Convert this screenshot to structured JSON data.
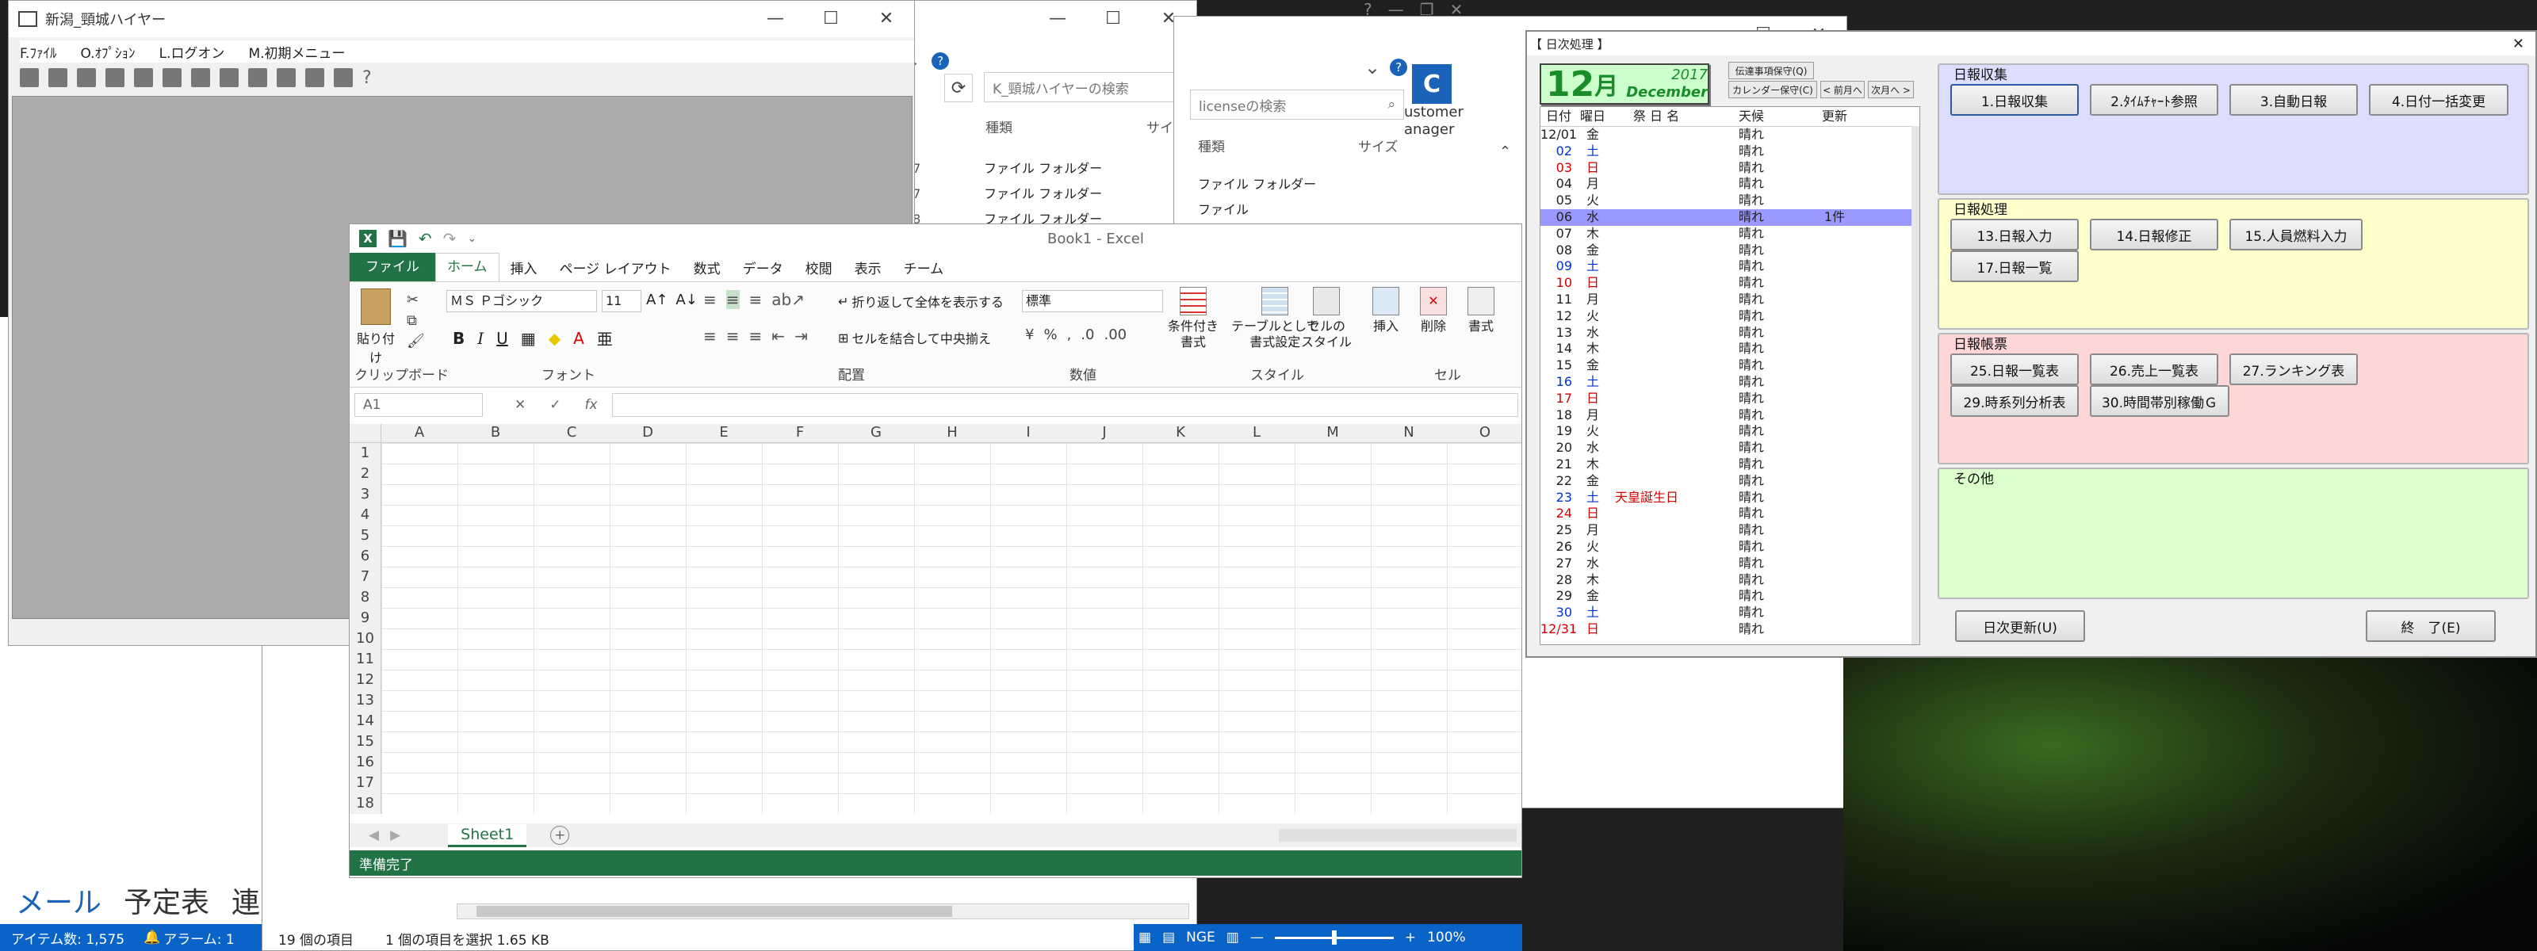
{
  "colors": {
    "excel_green": "#217346",
    "taskbar_blue": "#0a64c8",
    "outlook_blue": "#1a63b8",
    "cal_green": "#1a8c2a",
    "highlight_row": "#9999ff"
  },
  "haier_window": {
    "title": "新潟_頸城ハイヤー",
    "menu": [
      "F.ﾌｧｲﾙ",
      "O.ｵﾌﾟｼｮﾝ",
      "L.ログオン",
      "M.初期メニュー"
    ]
  },
  "explorer1": {
    "search_placeholder": "K_頸城ハイヤーの検索",
    "col_type": "種類",
    "col_size": "サイズ",
    "rows": [
      {
        "num": "57",
        "type": "ファイル フォルダー"
      },
      {
        "num": "57",
        "type": "ファイル フォルダー"
      },
      {
        "num": "58",
        "type": "ファイル フォルダー"
      }
    ]
  },
  "explorer2": {
    "search_placeholder": "licenseの検索",
    "col_type": "種類",
    "col_size": "サイズ",
    "rows": [
      "ファイル フォルダー",
      "ファイル"
    ],
    "customer_label1": "ustomer",
    "customer_label2": "anager"
  },
  "excel": {
    "title": "Book1 - Excel",
    "tabs": [
      "ファイル",
      "ホーム",
      "挿入",
      "ページ レイアウト",
      "数式",
      "データ",
      "校閲",
      "表示",
      "チーム"
    ],
    "paste_label": "貼り付け",
    "font_name": "ＭＳ Ｐゴシック",
    "font_size": "11",
    "wrap_text": "折り返して全体を表示する",
    "merge_center": "セルを結合して中央揃え",
    "number_format": "標準",
    "cond_format1": "条件付き",
    "cond_format2": "書式",
    "table_format1": "テーブルとして",
    "table_format2": "書式設定",
    "cell_style1": "セルの",
    "cell_style2": "スタイル",
    "insert_label": "挿入",
    "delete_label": "削除",
    "format_label": "書式",
    "group_clipboard": "クリップボード",
    "group_font": "フォント",
    "group_alignment": "配置",
    "group_number": "数値",
    "group_style": "スタイル",
    "group_cells": "セル",
    "name_box": "A1",
    "fx": "fx",
    "columns": [
      "A",
      "B",
      "C",
      "D",
      "E",
      "F",
      "G",
      "H",
      "I",
      "J",
      "K",
      "L",
      "M",
      "N",
      "O"
    ],
    "rows": [
      "1",
      "2",
      "3",
      "4",
      "5",
      "6",
      "7",
      "8",
      "9",
      "10",
      "11",
      "12",
      "13",
      "14",
      "15",
      "16",
      "17",
      "18"
    ],
    "sheet_tab": "Sheet1",
    "status": "準備完了"
  },
  "outlook": {
    "nav": [
      "メール",
      "予定表",
      "連"
    ],
    "status_items": "アイテム数: 1,575",
    "status_alarm": "アラーム: 1"
  },
  "explorer_status": {
    "count": "19 個の項目",
    "selected": "1 個の項目を選択  1.65 KB"
  },
  "excel_zoom": {
    "label": "NGE",
    "zoom": "100%"
  },
  "daily": {
    "title": "【 日次処理 】",
    "month_num": "12",
    "month_kanji": "月",
    "year": "2017",
    "month_en": "December",
    "btn_message": "伝達事項保守(Q)",
    "btn_calendar": "カレンダー保守(C)",
    "btn_prev": "< 前月へ",
    "btn_next": "次月へ >",
    "head_date": "日付",
    "head_dow": "曜日",
    "head_holiday": "祭 日 名",
    "head_weather": "天候",
    "head_update": "更新",
    "calendar": [
      {
        "date": "12/01",
        "dow": "金",
        "holiday": "",
        "weather": "晴れ",
        "update": ""
      },
      {
        "date": "02",
        "dow": "土",
        "holiday": "",
        "weather": "晴れ",
        "update": ""
      },
      {
        "date": "03",
        "dow": "日",
        "holiday": "",
        "weather": "晴れ",
        "update": ""
      },
      {
        "date": "04",
        "dow": "月",
        "holiday": "",
        "weather": "晴れ",
        "update": ""
      },
      {
        "date": "05",
        "dow": "火",
        "holiday": "",
        "weather": "晴れ",
        "update": ""
      },
      {
        "date": "06",
        "dow": "水",
        "holiday": "",
        "weather": "晴れ",
        "update": "1件"
      },
      {
        "date": "07",
        "dow": "木",
        "holiday": "",
        "weather": "晴れ",
        "update": ""
      },
      {
        "date": "08",
        "dow": "金",
        "holiday": "",
        "weather": "晴れ",
        "update": ""
      },
      {
        "date": "09",
        "dow": "土",
        "holiday": "",
        "weather": "晴れ",
        "update": ""
      },
      {
        "date": "10",
        "dow": "日",
        "holiday": "",
        "weather": "晴れ",
        "update": ""
      },
      {
        "date": "11",
        "dow": "月",
        "holiday": "",
        "weather": "晴れ",
        "update": ""
      },
      {
        "date": "12",
        "dow": "火",
        "holiday": "",
        "weather": "晴れ",
        "update": ""
      },
      {
        "date": "13",
        "dow": "水",
        "holiday": "",
        "weather": "晴れ",
        "update": ""
      },
      {
        "date": "14",
        "dow": "木",
        "holiday": "",
        "weather": "晴れ",
        "update": ""
      },
      {
        "date": "15",
        "dow": "金",
        "holiday": "",
        "weather": "晴れ",
        "update": ""
      },
      {
        "date": "16",
        "dow": "土",
        "holiday": "",
        "weather": "晴れ",
        "update": ""
      },
      {
        "date": "17",
        "dow": "日",
        "holiday": "",
        "weather": "晴れ",
        "update": ""
      },
      {
        "date": "18",
        "dow": "月",
        "holiday": "",
        "weather": "晴れ",
        "update": ""
      },
      {
        "date": "19",
        "dow": "火",
        "holiday": "",
        "weather": "晴れ",
        "update": ""
      },
      {
        "date": "20",
        "dow": "水",
        "holiday": "",
        "weather": "晴れ",
        "update": ""
      },
      {
        "date": "21",
        "dow": "木",
        "holiday": "",
        "weather": "晴れ",
        "update": ""
      },
      {
        "date": "22",
        "dow": "金",
        "holiday": "",
        "weather": "晴れ",
        "update": ""
      },
      {
        "date": "23",
        "dow": "土",
        "holiday": "天皇誕生日",
        "weather": "晴れ",
        "update": ""
      },
      {
        "date": "24",
        "dow": "日",
        "holiday": "",
        "weather": "晴れ",
        "update": ""
      },
      {
        "date": "25",
        "dow": "月",
        "holiday": "",
        "weather": "晴れ",
        "update": ""
      },
      {
        "date": "26",
        "dow": "火",
        "holiday": "",
        "weather": "晴れ",
        "update": ""
      },
      {
        "date": "27",
        "dow": "水",
        "holiday": "",
        "weather": "晴れ",
        "update": ""
      },
      {
        "date": "28",
        "dow": "木",
        "holiday": "",
        "weather": "晴れ",
        "update": ""
      },
      {
        "date": "29",
        "dow": "金",
        "holiday": "",
        "weather": "晴れ",
        "update": ""
      },
      {
        "date": "30",
        "dow": "土",
        "holiday": "",
        "weather": "晴れ",
        "update": ""
      },
      {
        "date": "12/31",
        "dow": "日",
        "holiday": "",
        "weather": "晴れ",
        "update": ""
      }
    ],
    "panel_collect": "日報収集",
    "panel_process": "日報処理",
    "panel_report": "日報帳票",
    "panel_other": "その他",
    "btn_collect": [
      "1.日報収集",
      "2.ﾀｲﾑﾁｬｰﾄ参照",
      "3.自動日報",
      "4.日付一括変更"
    ],
    "btn_process": [
      "13.日報入力",
      "14.日報修正",
      "15.人員燃料入力",
      "17.日報一覧"
    ],
    "btn_report": [
      "25.日報一覧表",
      "26.売上一覧表",
      "27.ランキング表",
      "29.時系列分析表",
      "30.時間帯別稼働Ｇ"
    ],
    "btn_update": "日次更新(U)",
    "btn_end": "終　了(E)"
  }
}
